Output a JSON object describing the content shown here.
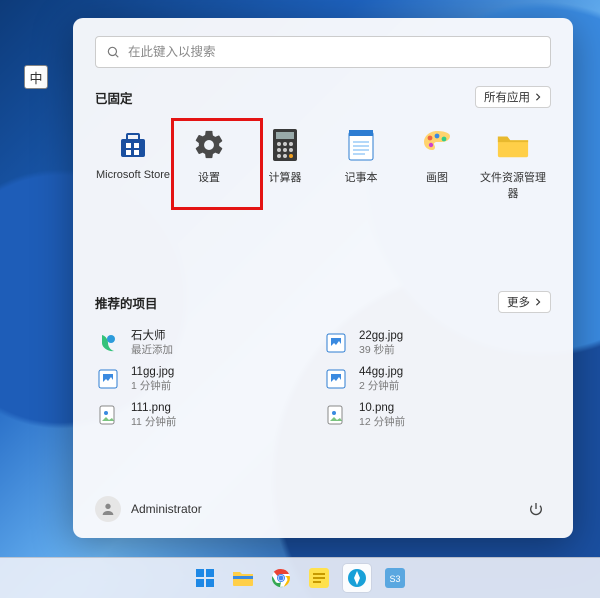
{
  "ime_badge": "中",
  "search": {
    "placeholder": "在此键入以搜索"
  },
  "pinned": {
    "title": "已固定",
    "all_apps_label": "所有应用",
    "items": [
      {
        "label": "Microsoft Store"
      },
      {
        "label": "设置"
      },
      {
        "label": "计算器"
      },
      {
        "label": "记事本"
      },
      {
        "label": "画图"
      },
      {
        "label": "文件资源管理器"
      }
    ]
  },
  "recent": {
    "title": "推荐的项目",
    "more_label": "更多",
    "items": [
      {
        "name": "石大师",
        "meta": "最近添加"
      },
      {
        "name": "22gg.jpg",
        "meta": "39 秒前"
      },
      {
        "name": "11gg.jpg",
        "meta": "1 分钟前"
      },
      {
        "name": "44gg.jpg",
        "meta": "2 分钟前"
      },
      {
        "name": "111.png",
        "meta": "11 分钟前"
      },
      {
        "name": "10.png",
        "meta": "12 分钟前"
      }
    ]
  },
  "user": {
    "name": "Administrator"
  }
}
